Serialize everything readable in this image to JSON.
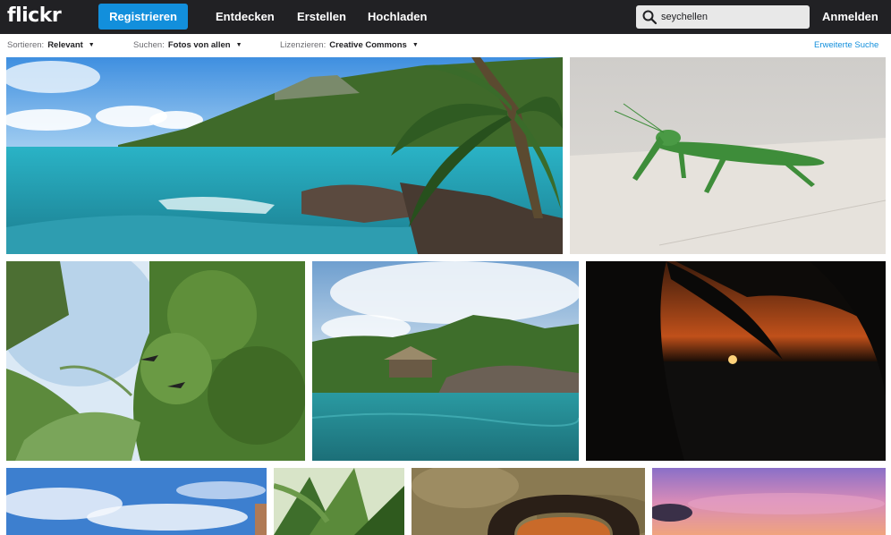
{
  "topbar": {
    "logo": "flickr",
    "register_label": "Registrieren",
    "nav": [
      "Entdecken",
      "Erstellen",
      "Hochladen"
    ],
    "search_value": "seychellen",
    "signin_label": "Anmelden"
  },
  "filters": {
    "sort": {
      "label": "Sortieren:",
      "value": "Relevant"
    },
    "search_scope": {
      "label": "Suchen:",
      "value": "Fotos von allen"
    },
    "license": {
      "label": "Lizenzieren:",
      "value": "Creative Commons"
    },
    "advanced_search": "Erweiterte Suche"
  },
  "photos": [
    {
      "name": "beach-palm-photo",
      "subject": "Beach with palm tree"
    },
    {
      "name": "mantis-photo",
      "subject": "Praying mantis"
    },
    {
      "name": "tree-photo",
      "subject": "Trees against sky"
    },
    {
      "name": "island-house-photo",
      "subject": "Island with house over water"
    },
    {
      "name": "sunset-palm-photo",
      "subject": "Sunset with palm silhouette"
    },
    {
      "name": "sky-photo",
      "subject": "Blue sky with clouds"
    },
    {
      "name": "plant-photo",
      "subject": "Green tropical plant"
    },
    {
      "name": "millipede-photo",
      "subject": "Millipede on ground"
    },
    {
      "name": "pink-sky-photo",
      "subject": "Pink evening sky"
    }
  ],
  "colors": {
    "topbar_bg": "#212124",
    "accent": "#128fdc",
    "search_bg": "#e8e8e8"
  }
}
